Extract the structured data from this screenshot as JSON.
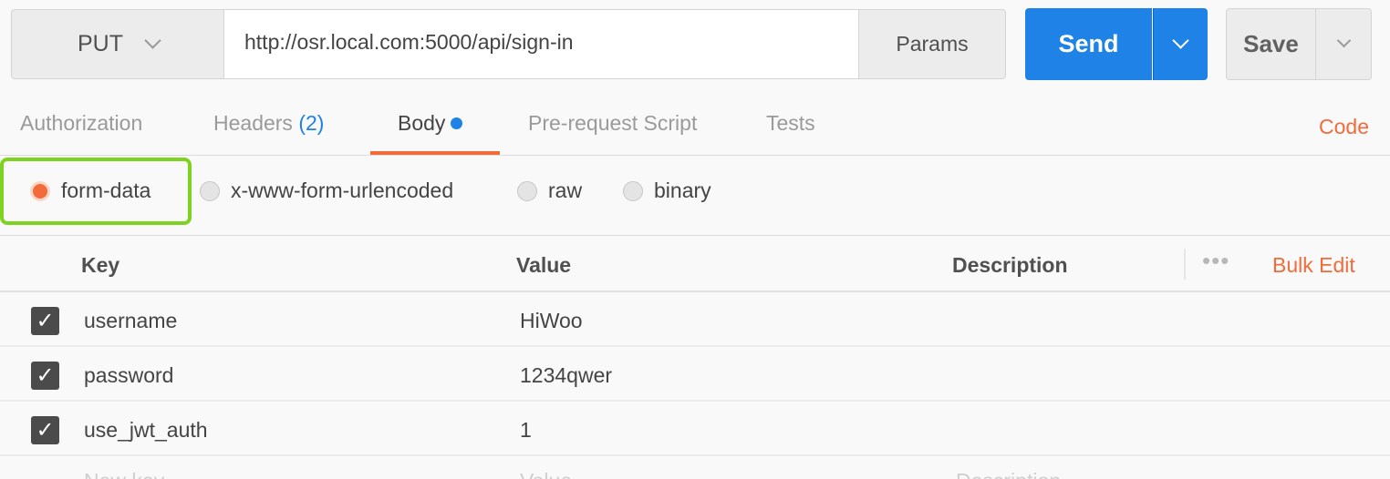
{
  "request": {
    "method": "PUT",
    "url": "http://osr.local.com:5000/api/sign-in",
    "params_label": "Params",
    "send_label": "Send",
    "save_label": "Save"
  },
  "tabs": [
    {
      "label": "Authorization"
    },
    {
      "label": "Headers",
      "count": "(2)"
    },
    {
      "label": "Body",
      "active": true
    },
    {
      "label": "Pre-request Script"
    },
    {
      "label": "Tests"
    }
  ],
  "code_label": "Code",
  "body_types": [
    {
      "label": "form-data",
      "selected": true
    },
    {
      "label": "x-www-form-urlencoded",
      "selected": false
    },
    {
      "label": "raw",
      "selected": false
    },
    {
      "label": "binary",
      "selected": false
    }
  ],
  "table": {
    "headers": {
      "key": "Key",
      "value": "Value",
      "description": "Description"
    },
    "bulk_edit_label": "Bulk Edit",
    "rows": [
      {
        "key": "username",
        "value": "HiWoo",
        "description": "",
        "checked": true
      },
      {
        "key": "password",
        "value": "1234qwer",
        "description": "",
        "checked": true
      },
      {
        "key": "use_jwt_auth",
        "value": "1",
        "description": "",
        "checked": true
      }
    ],
    "placeholder": {
      "key": "New key",
      "value": "Value",
      "description": "Description"
    }
  },
  "colors": {
    "accent_blue": "#1f82e6",
    "accent_orange": "#f26b3a",
    "highlight_green": "#7ed321"
  }
}
